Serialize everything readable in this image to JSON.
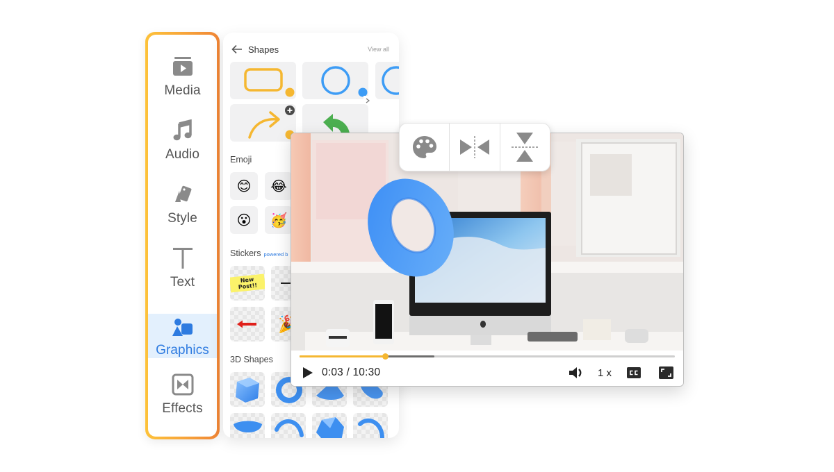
{
  "colors": {
    "accent": "#2e7be0",
    "sidebar_border_start": "#fdc23a",
    "sidebar_border_end": "#ef8435",
    "progress_played": "#f5b731",
    "shape_yellow": "#f5b731",
    "shape_blue": "#3d9cf5",
    "shape_green": "#4caf50",
    "icon_gray": "#8a8a8a"
  },
  "sidebar": {
    "active": "Graphics",
    "items": [
      {
        "id": "media",
        "label": "Media",
        "icon": "media-icon"
      },
      {
        "id": "audio",
        "label": "Audio",
        "icon": "music-note-icon"
      },
      {
        "id": "style",
        "label": "Style",
        "icon": "style-swatch-icon"
      },
      {
        "id": "text",
        "label": "Text",
        "icon": "text-icon"
      },
      {
        "id": "graphics",
        "label": "Graphics",
        "icon": "graphics-shapes-icon"
      },
      {
        "id": "effects",
        "label": "Effects",
        "icon": "effects-transition-icon"
      }
    ]
  },
  "panel": {
    "header": {
      "title": "Shapes",
      "back_icon": "arrow-left-icon",
      "view_all": "View all"
    },
    "shapes": [
      {
        "name": "rounded-rectangle",
        "color": "yellow"
      },
      {
        "name": "circle",
        "color": "blue"
      },
      {
        "name": "circle-partial",
        "color": "blue"
      },
      {
        "name": "curved-arrow",
        "color": "yellow"
      },
      {
        "name": "curved-back-arrow",
        "color": "green"
      }
    ],
    "sections": {
      "emoji": "Emoji",
      "stickers": "Stickers",
      "stickers_powered": "powered b",
      "shapes_3d": "3D Shapes"
    },
    "emoji": [
      "😊",
      "😂",
      "😮",
      "🥳"
    ],
    "stickers": [
      {
        "name": "new-post-sticker",
        "text": "New Post!!"
      },
      {
        "name": "line-sticker"
      },
      {
        "name": "red-arrow-sticker"
      },
      {
        "name": "party-popper-sticker",
        "text": "🎉"
      }
    ],
    "shapes_3d": [
      "cube",
      "torus",
      "cone",
      "cylinder-slice",
      "hemisphere",
      "half-ring",
      "icosahedron",
      "arc-ring"
    ]
  },
  "toolbar": {
    "buttons": [
      {
        "name": "color-palette",
        "icon": "palette-icon"
      },
      {
        "name": "flip-horizontal",
        "icon": "flip-horizontal-icon"
      },
      {
        "name": "flip-vertical",
        "icon": "flip-vertical-icon"
      }
    ]
  },
  "player": {
    "time_display": "0:03 / 10:30",
    "current_time": "0:03",
    "duration": "10:30",
    "played_fraction": 0.228,
    "buffered_fraction": 0.36,
    "speed": "1 x",
    "cc_label": "CC",
    "scene_overlay": "blue-3d-torus"
  }
}
